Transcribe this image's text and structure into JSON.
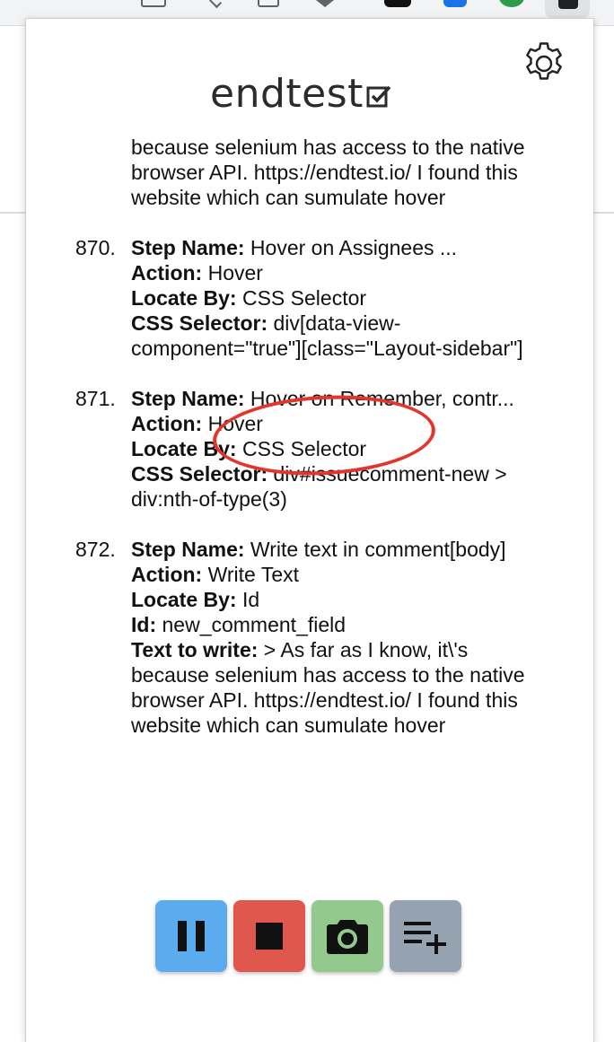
{
  "app": {
    "logo_text": "endtest"
  },
  "steps": [
    {
      "number": "",
      "lines": [
        {
          "label": "Text to write:",
          "value": " > As far as I know, it\\'s because selenium has access to the native browser API. https://endtest.io/ I found this website which can sumulate hover"
        }
      ]
    },
    {
      "number": "870.",
      "lines": [
        {
          "label": "Step Name:",
          "value": " Hover on Assignees ..."
        },
        {
          "label": "Action:",
          "value": " Hover"
        },
        {
          "label": "Locate By:",
          "value": " CSS Selector"
        },
        {
          "label": "CSS Selector:",
          "value": " div[data-view-component=\"true\"][class=\"Layout-sidebar\"]"
        }
      ]
    },
    {
      "number": "871.",
      "lines": [
        {
          "label": "Step Name:",
          "value": " Hover on Remember, contr..."
        },
        {
          "label": "Action:",
          "value": " Hover"
        },
        {
          "label": "Locate By:",
          "value": " CSS Selector"
        },
        {
          "label": "CSS Selector:",
          "value": " div#issuecomment-new > div:nth-of-type(3)"
        }
      ]
    },
    {
      "number": "872.",
      "lines": [
        {
          "label": "Step Name:",
          "value": " Write text in comment[body]"
        },
        {
          "label": "Action:",
          "value": " Write Text"
        },
        {
          "label": "Locate By:",
          "value": " Id"
        },
        {
          "label": "Id:",
          "value": " new_comment_field"
        },
        {
          "label": "Text to write:",
          "value": " > As far as I know, it\\'s because selenium has access to the native browser API. https://endtest.io/ I found this website which can sumulate hover"
        }
      ]
    }
  ],
  "controls": [
    {
      "name": "pause-button",
      "icon": "pause-icon",
      "color": "#5aacef"
    },
    {
      "name": "stop-button",
      "icon": "stop-icon",
      "color": "#e0574e"
    },
    {
      "name": "screenshot-button",
      "icon": "camera-icon",
      "color": "#93c98d"
    },
    {
      "name": "add-step-button",
      "icon": "playlist-add-icon",
      "color": "#95a3b0"
    }
  ],
  "annotation": {
    "highlight_color": "#e2362c"
  }
}
